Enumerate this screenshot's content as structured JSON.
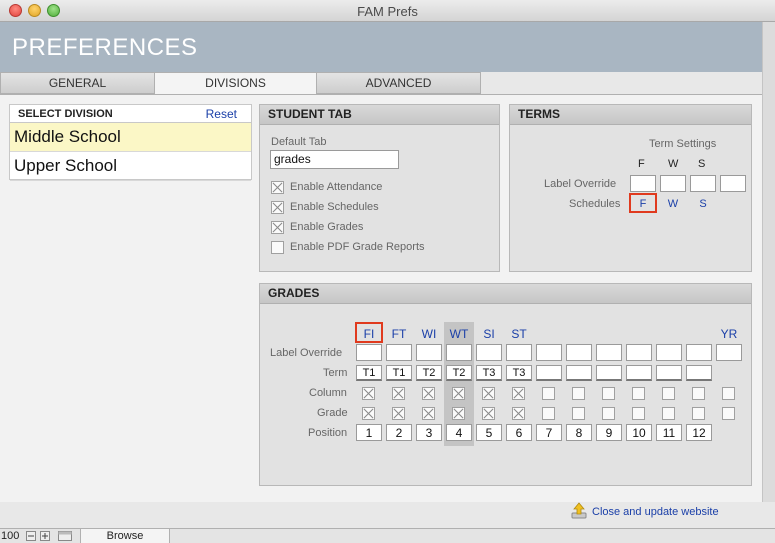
{
  "window": {
    "title": "FAM Prefs"
  },
  "header": {
    "title": "PREFERENCES"
  },
  "tabs": [
    {
      "label": "GENERAL"
    },
    {
      "label": "DIVISIONS"
    },
    {
      "label": "ADVANCED"
    }
  ],
  "divisions": {
    "title": "SELECT DIVISION",
    "reset_label": "Reset",
    "items": [
      {
        "label": "Middle School"
      },
      {
        "label": "Upper School"
      }
    ]
  },
  "student_tab": {
    "title": "STUDENT TAB",
    "default_tab_label": "Default Tab",
    "default_tab_value": "grades",
    "options": [
      {
        "label": "Enable Attendance",
        "checked": true
      },
      {
        "label": "Enable Schedules",
        "checked": true
      },
      {
        "label": "Enable Grades",
        "checked": true
      },
      {
        "label": "Enable PDF Grade Reports",
        "checked": false
      }
    ]
  },
  "terms": {
    "title": "TERMS",
    "settings_label": "Term Settings",
    "headers": [
      "F",
      "W",
      "S"
    ],
    "label_override_label": "Label Override",
    "schedules_label": "Schedules",
    "schedules": [
      "F",
      "W",
      "S"
    ]
  },
  "grades": {
    "title": "GRADES",
    "columns": [
      "FI",
      "FT",
      "WI",
      "WT",
      "SI",
      "ST",
      "",
      "",
      "",
      "",
      "",
      "",
      "YR"
    ],
    "row_labels": {
      "label_override": "Label Override",
      "term": "Term",
      "column": "Column",
      "grade": "Grade",
      "position": "Position"
    },
    "terms": [
      "T1",
      "T1",
      "T2",
      "T2",
      "T3",
      "T3",
      "",
      "",
      "",
      "",
      "",
      ""
    ],
    "positions": [
      "1",
      "2",
      "3",
      "4",
      "5",
      "6",
      "7",
      "8",
      "9",
      "10",
      "11",
      "12"
    ]
  },
  "footer": {
    "close_label": "Close and update website"
  },
  "statusbar": {
    "zoom": "100",
    "mode": "Browse"
  }
}
